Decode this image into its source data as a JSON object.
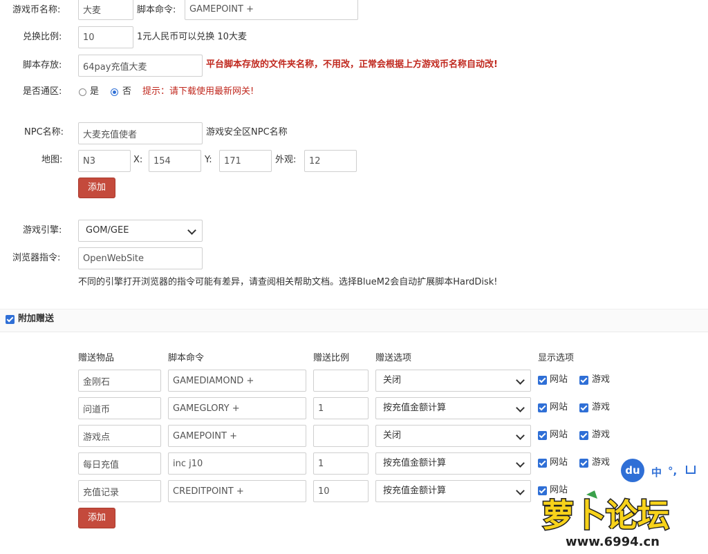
{
  "form": {
    "currency_name": {
      "label": "游戏币名称:",
      "value": "大麦"
    },
    "script_cmd": {
      "label": "脚本命令:",
      "value": "GAMEPOINT +"
    },
    "ratio": {
      "label": "兑换比例:",
      "value": "10",
      "note": "1元人民币可以兑换 10大麦"
    },
    "storage": {
      "label": "脚本存放:",
      "value": "64pay充值大麦",
      "note": "平台脚本存放的文件夹名称，不用改，正常会根据上方游戏币名称自动改!"
    },
    "universal": {
      "label": "是否通区:",
      "yes": "是",
      "no": "否",
      "selected": "否",
      "hint": "提示：请下载使用最新网关!"
    },
    "npc": {
      "label": "NPC名称:",
      "value": "大麦充值使者",
      "note": "游戏安全区NPC名称"
    },
    "map": {
      "label": "地图:",
      "map_value": "N3",
      "x_label": "X:",
      "x_value": "154",
      "y_label": "Y:",
      "y_value": "171",
      "look_label": "外观:",
      "look_value": "12"
    },
    "add_button": "添加",
    "engine": {
      "label": "游戏引擎:",
      "value": "GOM/GEE"
    },
    "browser": {
      "label": "浏览器指令:",
      "value": "OpenWebSite",
      "note": "不同的引擎打开浏览器的指令可能有差异，请查阅相关帮助文档。选择BlueM2会自动扩展脚本HardDisk!"
    }
  },
  "bonus": {
    "section_title": "附加赠送",
    "checked": true,
    "headers": [
      "赠送物品",
      "脚本命令",
      "赠送比例",
      "赠送选项",
      "显示选项"
    ],
    "rows": [
      {
        "item": "金刚石",
        "cmd": "GAMEDIAMOND +",
        "ratio": "",
        "option": "关闭",
        "site": "网站",
        "game": "游戏"
      },
      {
        "item": "问道币",
        "cmd": "GAMEGLORY +",
        "ratio": "1",
        "option": "按充值金额计算",
        "site": "网站",
        "game": "游戏"
      },
      {
        "item": "游戏点",
        "cmd": "GAMEPOINT +",
        "ratio": "",
        "option": "关闭",
        "site": "网站",
        "game": "游戏"
      },
      {
        "item": "每日充值",
        "cmd": "inc j10",
        "ratio": "1",
        "option": "按充值金额计算",
        "site": "网站",
        "game": "游戏"
      },
      {
        "item": "充值记录",
        "cmd": "CREDITPOINT +",
        "ratio": "10",
        "option": "按充值金额计算",
        "site": "网站",
        "game": ""
      }
    ],
    "add_button": "添加"
  },
  "overlay": {
    "ime_badge": "du",
    "ime_lang": "中",
    "ime_punct": "°,",
    "watermark_text": "萝卜论坛",
    "watermark_url": "www.6994.cn"
  },
  "colors": {
    "accent": "#2f6fd6",
    "button": "#c44a3c",
    "warn": "#c0281e"
  }
}
